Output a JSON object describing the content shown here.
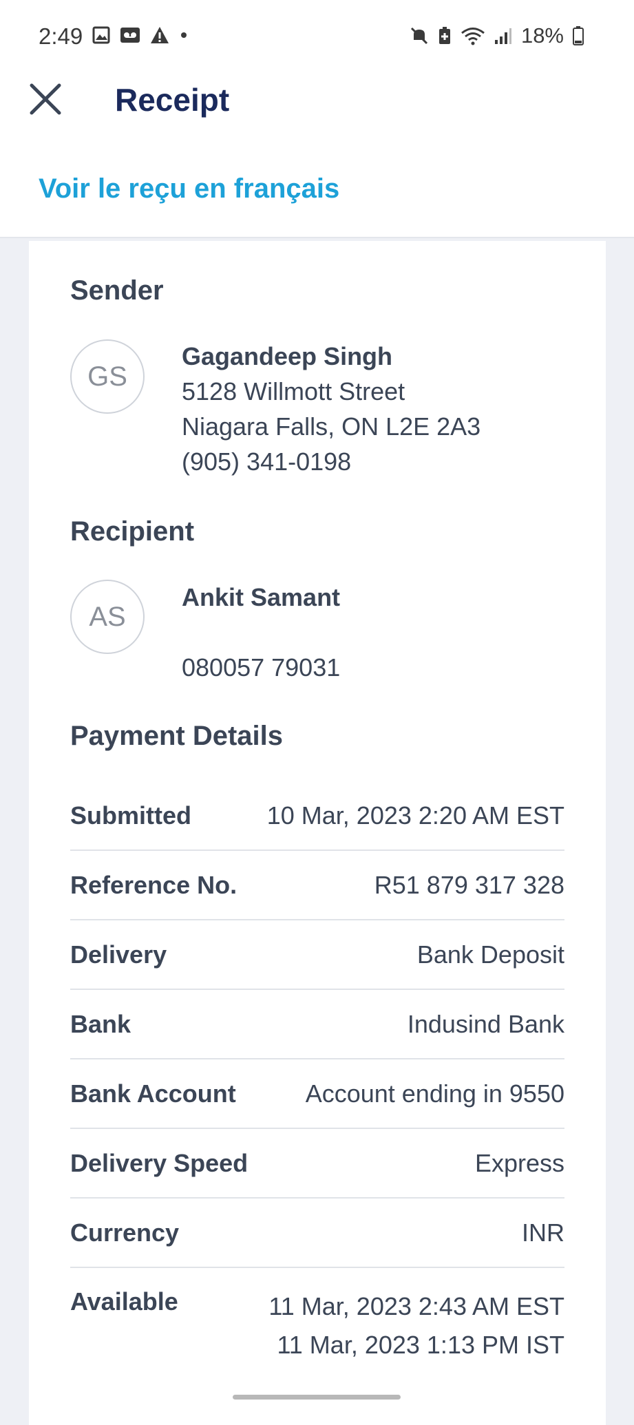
{
  "status_bar": {
    "time": "2:49",
    "battery": "18%",
    "icons_left": [
      "image-icon",
      "voicemail-icon",
      "warning-icon",
      "dot-icon"
    ],
    "icons_right": [
      "mute-icon",
      "battery-saver-icon",
      "wifi-icon",
      "signal-icon",
      "battery-icon"
    ]
  },
  "header": {
    "title": "Receipt",
    "french_link": "Voir le reçu en français"
  },
  "sender": {
    "section_title": "Sender",
    "initials": "GS",
    "name": "Gagandeep Singh",
    "address1": "5128 Willmott Street",
    "address2": "Niagara Falls, ON L2E 2A3",
    "phone": "(905) 341-0198"
  },
  "recipient": {
    "section_title": "Recipient",
    "initials": "AS",
    "name": "Ankit Samant",
    "phone": "080057 79031"
  },
  "payment": {
    "section_title": "Payment Details",
    "rows": [
      {
        "label": "Submitted",
        "value": "10 Mar, 2023 2:20 AM EST"
      },
      {
        "label": "Reference No.",
        "value": "R51 879 317 328"
      },
      {
        "label": "Delivery",
        "value": "Bank Deposit"
      },
      {
        "label": "Bank",
        "value": "Indusind Bank"
      },
      {
        "label": "Bank Account",
        "value": "Account ending in 9550"
      },
      {
        "label": "Delivery Speed",
        "value": "Express"
      },
      {
        "label": "Currency",
        "value": "INR"
      },
      {
        "label": "Available",
        "value": "11 Mar, 2023 2:43 AM EST",
        "value2": "11 Mar, 2023 1:13 PM IST"
      }
    ]
  },
  "colors": {
    "title": "#1b2a5c",
    "link": "#1da1d8",
    "text": "#3b4556",
    "background": "#eef0f5"
  }
}
